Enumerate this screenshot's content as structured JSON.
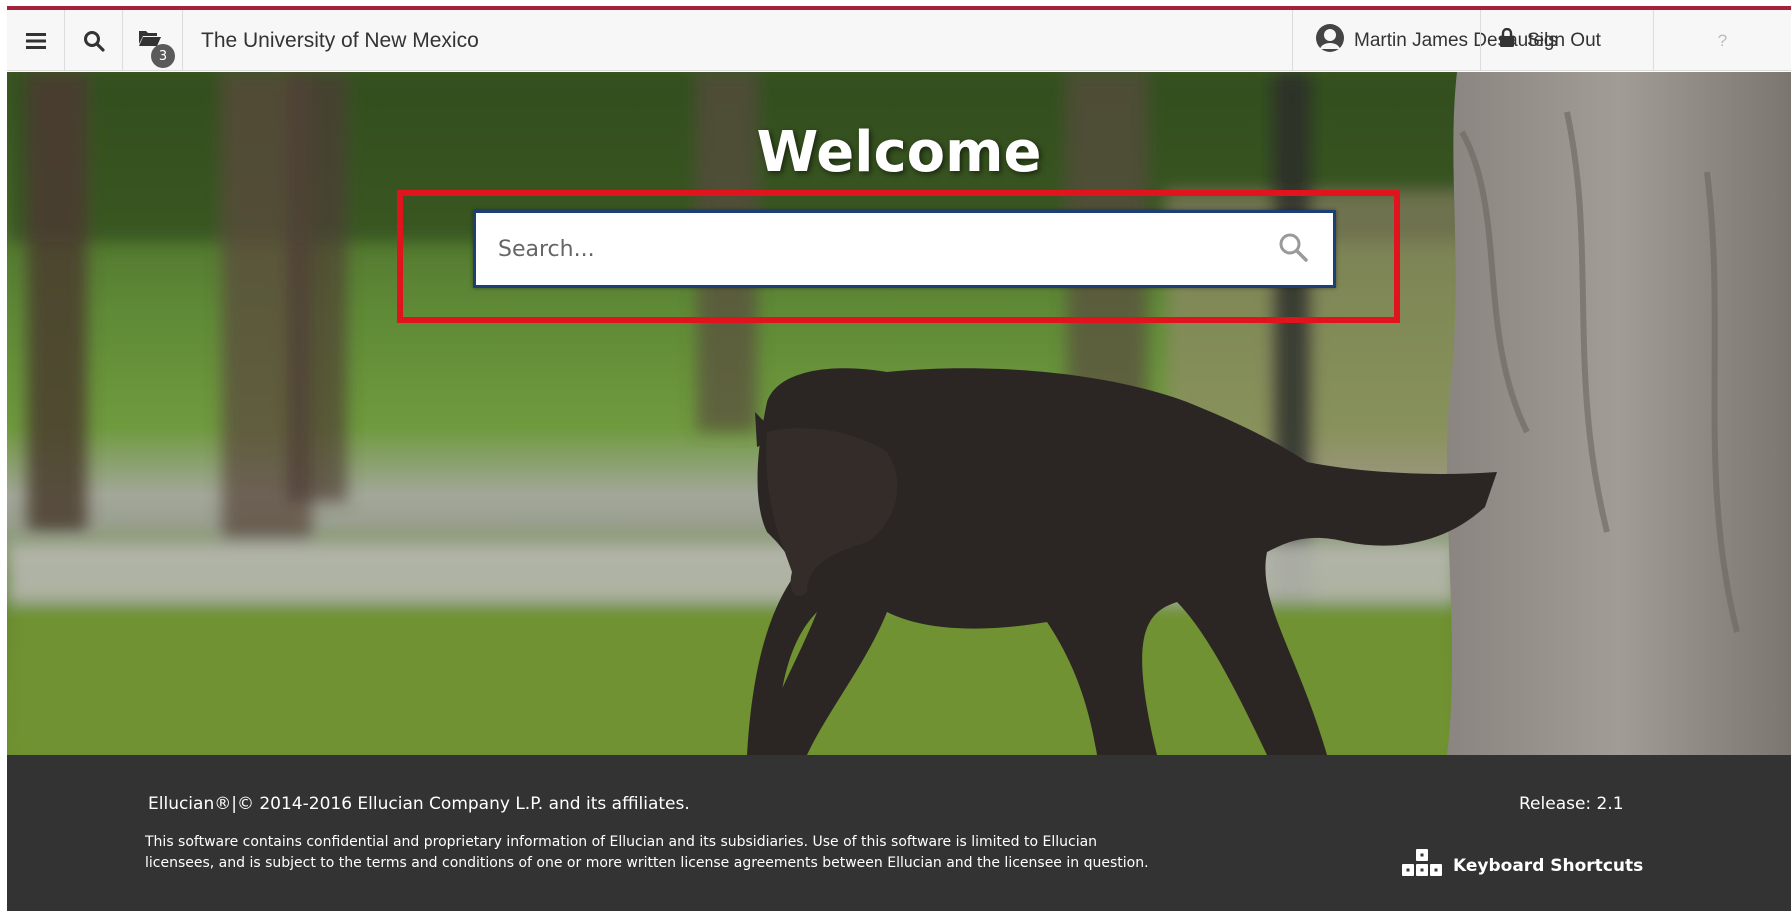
{
  "header": {
    "menu_icon": "hamburger-menu-icon",
    "search_icon": "search-icon",
    "recent_icon": "folder-stack-icon",
    "recent_count": "3",
    "app_title": "The University of New Mexico",
    "user_name": "Martin James Desautels",
    "sign_out_label": "Sign Out",
    "help_label": "?"
  },
  "hero": {
    "welcome_text": "Welcome",
    "search_placeholder": "Search..."
  },
  "footer": {
    "copyright": "Ellucian®|© 2014-2016 Ellucian Company L.P. and its affiliates.",
    "disclaimer": "This software contains confidential and proprietary information of Ellucian and its subsidiaries. Use of this software is limited to Ellucian licensees, and is subject to the terms and conditions of one or more written license agreements between Ellucian and the licensee in question.",
    "release": "Release: 2.1",
    "keyboard_shortcuts_label": "Keyboard Shortcuts"
  },
  "colors": {
    "accent_bar": "#a3223a",
    "highlight_border": "#e0141c",
    "search_border": "#1d3f78",
    "footer_bg": "#333333"
  }
}
